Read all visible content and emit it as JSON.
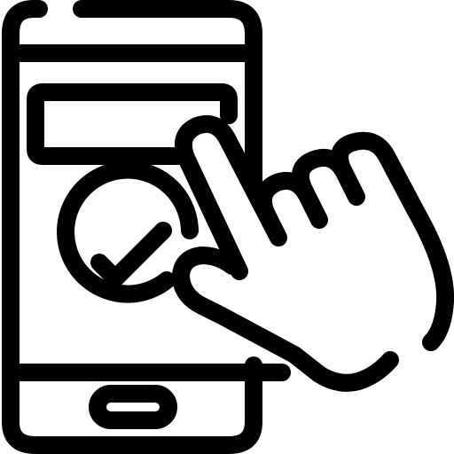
{
  "icon": {
    "name": "smartphone-tap-confirm-icon",
    "parts": [
      "smartphone-icon",
      "checkmark-icon",
      "pointing-hand-icon"
    ]
  },
  "colors": {
    "stroke": "#000000",
    "background": "#ffffff"
  }
}
